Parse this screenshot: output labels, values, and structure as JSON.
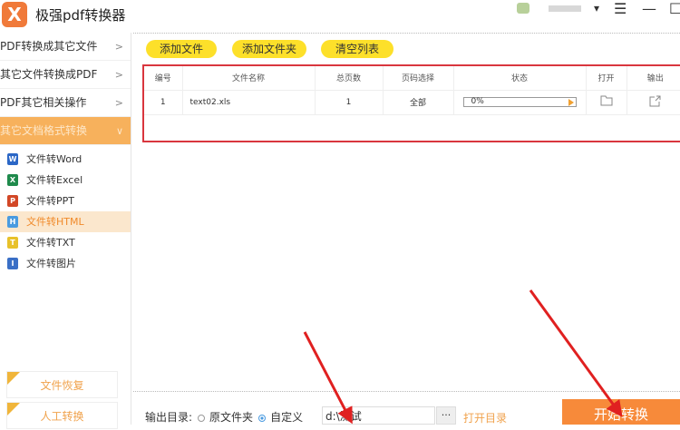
{
  "app": {
    "title": "极强pdf转换器",
    "logo": "X"
  },
  "window": {
    "dropdown": "▾",
    "menu": "☰",
    "minimize": "—",
    "maximize": "☐"
  },
  "sidebar": {
    "menus": [
      {
        "label": "PDF转换成其它文件",
        "arrow": ">"
      },
      {
        "label": "其它文件转换成PDF",
        "arrow": ">"
      },
      {
        "label": "PDF其它相关操作",
        "arrow": ">"
      },
      {
        "label": "其它文档格式转换",
        "arrow": "∨"
      }
    ],
    "subitems": [
      {
        "label": "文件转Word",
        "icon": "W",
        "color": "#2b67c6"
      },
      {
        "label": "文件转Excel",
        "icon": "X",
        "color": "#1f8a4c"
      },
      {
        "label": "文件转PPT",
        "icon": "P",
        "color": "#d24726"
      },
      {
        "label": "文件转HTML",
        "icon": "H",
        "color": "#4a9be0"
      },
      {
        "label": "文件转TXT",
        "icon": "T",
        "color": "#e8c12a"
      },
      {
        "label": "文件转图片",
        "icon": "I",
        "color": "#3a6fc6"
      }
    ],
    "recover": "文件恢复",
    "manual": "人工转换"
  },
  "toolbar": {
    "add_file": "添加文件",
    "add_folder": "添加文件夹",
    "clear": "清空列表"
  },
  "table": {
    "headers": [
      "编号",
      "文件名称",
      "总页数",
      "页码选择",
      "状态",
      "打开",
      "输出"
    ],
    "rows": [
      {
        "no": "1",
        "name": "text02.xls",
        "pages": "1",
        "range": "全部",
        "progress": "0%"
      }
    ]
  },
  "bottom": {
    "output_label": "输出目录:",
    "opt_original": "原文件夹",
    "opt_custom": "自定义",
    "path": "d:\\测试",
    "browse": "···",
    "open_dir": "打开目录",
    "start": "开始转换"
  }
}
